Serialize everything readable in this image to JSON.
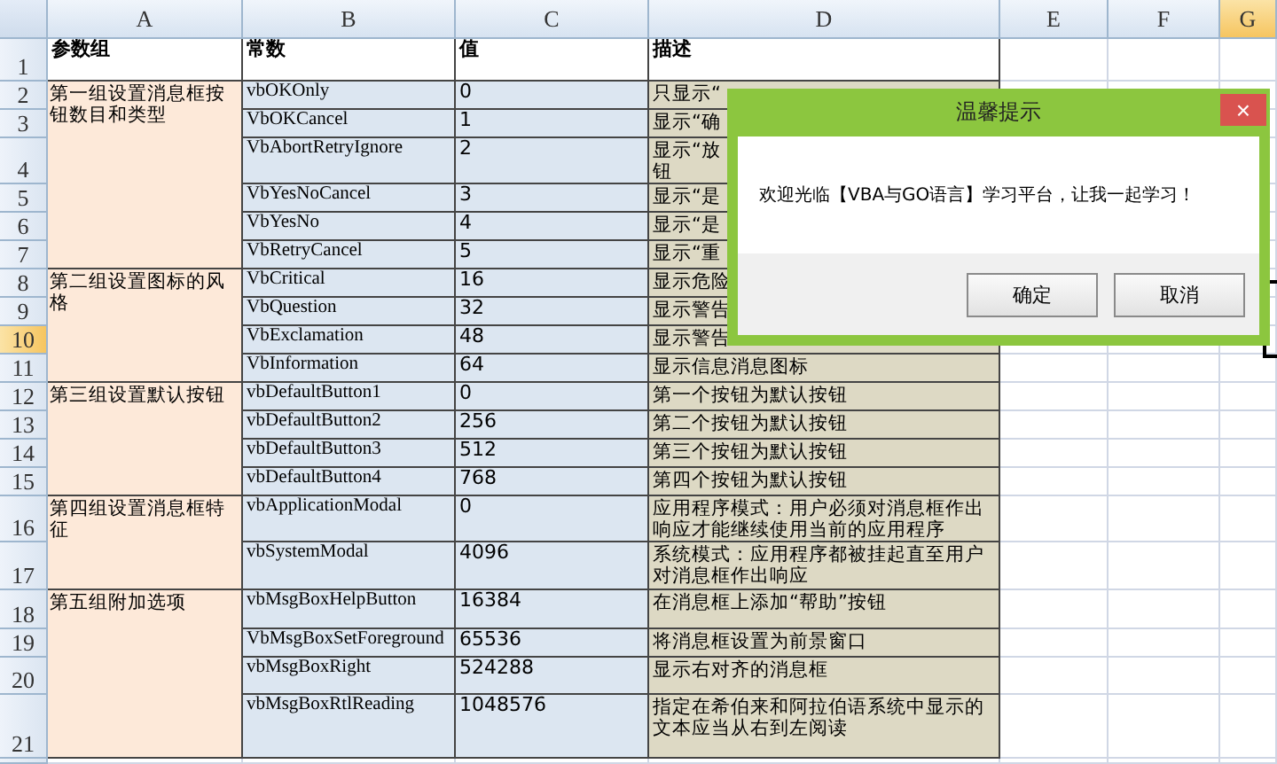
{
  "columns": [
    {
      "label": "A",
      "selected": false
    },
    {
      "label": "B",
      "selected": false
    },
    {
      "label": "C",
      "selected": false
    },
    {
      "label": "D",
      "selected": false
    },
    {
      "label": "E",
      "selected": false
    },
    {
      "label": "F",
      "selected": false
    },
    {
      "label": "G",
      "selected": true
    }
  ],
  "header_row": {
    "number": "1",
    "selected": false,
    "cells": [
      "参数组",
      "常数",
      "值",
      "描述"
    ]
  },
  "groups": [
    {
      "name": "第一组设置消息框按钮数目和类型",
      "rows": [
        {
          "number": "2",
          "selected": false,
          "constant": "vbOKOnly",
          "value": "0",
          "description": [
            "只显示“"
          ]
        },
        {
          "number": "3",
          "selected": false,
          "constant": "VbOKCancel",
          "value": "1",
          "description": [
            "显示“确"
          ]
        },
        {
          "number": "4",
          "selected": false,
          "constant": "VbAbortRetryIgnore",
          "value": "2",
          "description": [
            "显示“放",
            "钮"
          ]
        },
        {
          "number": "5",
          "selected": false,
          "constant": "VbYesNoCancel",
          "value": "3",
          "description": [
            "显示“是"
          ]
        },
        {
          "number": "6",
          "selected": false,
          "constant": "VbYesNo",
          "value": "4",
          "description": [
            "显示“是"
          ]
        },
        {
          "number": "7",
          "selected": false,
          "constant": "VbRetryCancel",
          "value": "5",
          "description": [
            "显示“重"
          ]
        }
      ]
    },
    {
      "name": "第二组设置图标的风格",
      "rows": [
        {
          "number": "8",
          "selected": false,
          "constant": "VbCritical",
          "value": "16",
          "description": [
            "显示危险"
          ]
        },
        {
          "number": "9",
          "selected": false,
          "constant": "VbQuestion",
          "value": "32",
          "description": [
            "显示警告"
          ]
        },
        {
          "number": "10",
          "selected": true,
          "constant": "VbExclamation",
          "value": "48",
          "description": [
            "显示警告"
          ]
        },
        {
          "number": "11",
          "selected": false,
          "constant": "VbInformation",
          "value": "64",
          "description": [
            "显示信息消息图标"
          ]
        }
      ]
    },
    {
      "name": "第三组设置默认按钮",
      "rows": [
        {
          "number": "12",
          "selected": false,
          "constant": "vbDefaultButton1",
          "value": "0",
          "description": [
            "第一个按钮为默认按钮"
          ]
        },
        {
          "number": "13",
          "selected": false,
          "constant": "vbDefaultButton2",
          "value": "256",
          "description": [
            "第二个按钮为默认按钮"
          ]
        },
        {
          "number": "14",
          "selected": false,
          "constant": "vbDefaultButton3",
          "value": "512",
          "description": [
            "第三个按钮为默认按钮"
          ]
        },
        {
          "number": "15",
          "selected": false,
          "constant": "vbDefaultButton4",
          "value": "768",
          "description": [
            "第四个按钮为默认按钮"
          ]
        }
      ]
    },
    {
      "name": "第四组设置消息框特征",
      "rows": [
        {
          "number": "16",
          "selected": false,
          "constant": "vbApplicationModal",
          "value": "0",
          "description": [
            "应用程序模式：用户必须对消息框作出响应才能继续使用当前的应用程序"
          ]
        },
        {
          "number": "17",
          "selected": false,
          "constant": "vbSystemModal",
          "value": "4096",
          "description": [
            "系统模式：应用程序都被挂起直至用户对消息框作出响应"
          ]
        }
      ]
    },
    {
      "name": "第五组附加选项",
      "rows": [
        {
          "number": "18",
          "selected": false,
          "constant": "vbMsgBoxHelpButton",
          "value": "16384",
          "description": [
            "在消息框上添加“帮助”按钮"
          ]
        },
        {
          "number": "19",
          "selected": false,
          "constant": "VbMsgBoxSetForeground",
          "value": "65536",
          "description": [
            "将消息框设置为前景窗口"
          ]
        },
        {
          "number": "20",
          "selected": false,
          "constant": "vbMsgBoxRight",
          "value": "524288",
          "description": [
            "显示右对齐的消息框"
          ]
        },
        {
          "number": "21",
          "selected": false,
          "constant": "vbMsgBoxRtlReading",
          "value": "1048576",
          "description": [
            "指定在希伯来和阿拉伯语系统中显示的文本应当从右到左阅读"
          ]
        }
      ]
    }
  ],
  "dialog": {
    "title": "温馨提示",
    "close": "×",
    "message": "欢迎光临【VBA与GO语言】学习平台，让我一起学习！",
    "buttons": [
      "确定",
      "取消"
    ]
  }
}
